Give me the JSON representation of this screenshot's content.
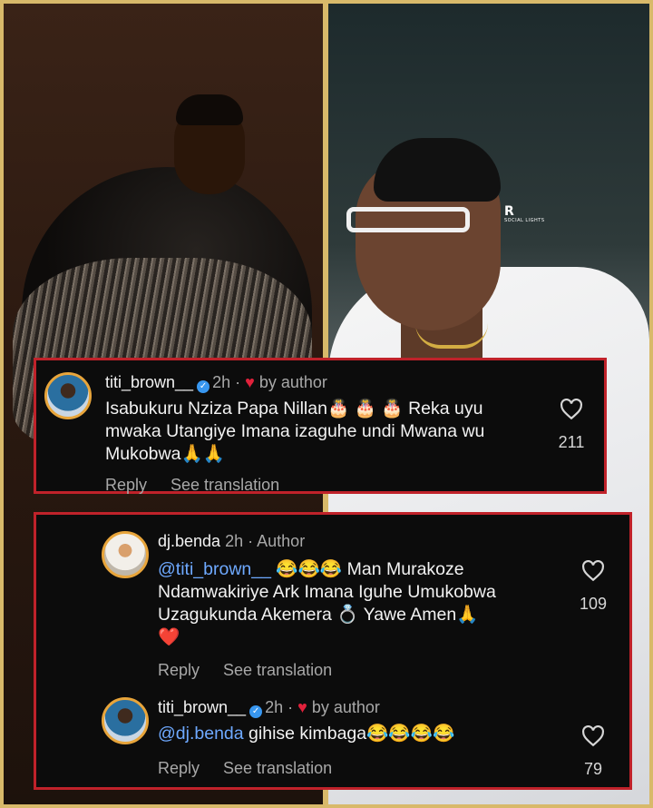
{
  "background_photo": {
    "watermark_mark": "R",
    "watermark_text": "SOCIAL LIGHTS"
  },
  "comments": [
    {
      "username": "titi_brown__",
      "time": "2h",
      "separator": "·",
      "liked_by_label": "by author",
      "text_parts": [
        "Isabukuru Nziza Papa Nillan",
        "🎂 🎂 🎂",
        " Reka uyu mwaka Utangiye Imana izaguhe undi Mwana wu Mukobwa",
        "🙏🙏"
      ],
      "likes": "211",
      "reply_label": "Reply",
      "translation_label": "See translation"
    },
    {
      "username": "dj.benda",
      "time": "2h",
      "separator": "·",
      "author_label": "Author",
      "mention": "@titi_brown__",
      "text": "😂😂😂 Man Murakoze Ndamwakiriye Ark Imana Iguhe Umukobwa Uzagukunda Akemera 💍 Yawe Amen🙏",
      "emoji_line": "❤️",
      "likes": "109",
      "reply_label": "Reply",
      "translation_label": "See translation"
    },
    {
      "username": "titi_brown__",
      "time": "2h",
      "separator": "·",
      "liked_by_label": "by author",
      "mention": "@dj.benda",
      "text": " gihise kimbaga😂😂😂😂",
      "likes": "79",
      "reply_label": "Reply",
      "translation_label": "See translation"
    }
  ],
  "colors": {
    "frame_gold": "#d8b96a",
    "card_border": "#c0222a",
    "mention_blue": "#6ea9ff",
    "verified_blue": "#3897f0",
    "heart_red": "#e1213b"
  },
  "icons": {
    "verified": "verified-badge-icon",
    "liked": "heart-filled-icon",
    "like": "heart-outline-icon"
  }
}
